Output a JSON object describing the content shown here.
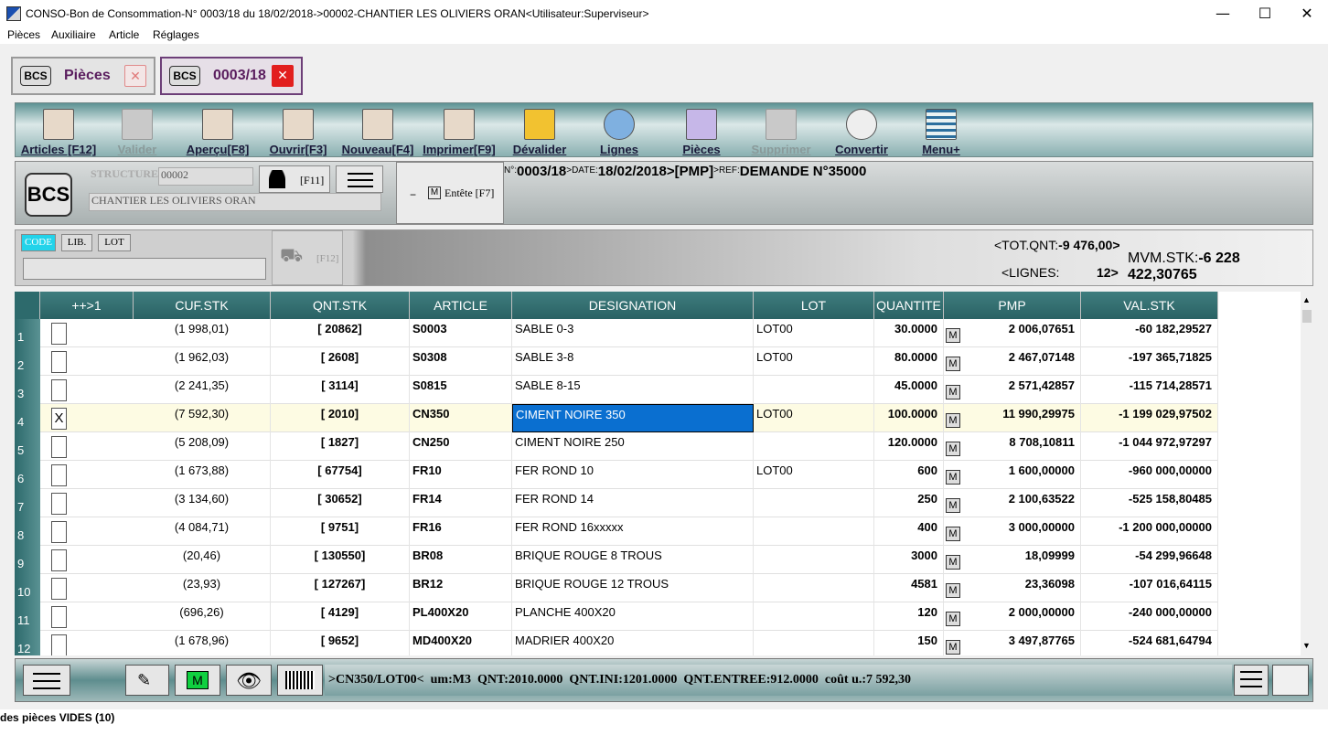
{
  "window": {
    "title": "CONSO-Bon de Consommation-N° 0003/18 du 18/02/2018->00002-CHANTIER LES OLIVIERS ORAN<Utilisateur:Superviseur>",
    "min": "—",
    "max": "☐",
    "close": "✕"
  },
  "menu": [
    "Pièces",
    "Auxiliaire",
    "Article",
    "Réglages"
  ],
  "tabs": [
    {
      "icon": "BCS",
      "label": "Pièces",
      "close": "✕"
    },
    {
      "icon": "BCS",
      "label": "0003/18",
      "close": "✕"
    }
  ],
  "toolbar": [
    "Articles [F12]",
    "Valider",
    "Aperçu[F8]",
    "Ouvrir[F3]",
    "Nouveau[F4]",
    "Imprimer[F9]",
    "Dévalider",
    "Lignes",
    "Pièces",
    "Supprimer",
    "Convertir",
    "Menu+"
  ],
  "header": {
    "logo": "BCS",
    "structure_label": "STRUCTURE",
    "structure_value": "00002",
    "structure_name": "CHANTIER LES OLIVIERS ORAN",
    "f11": "[F11]",
    "entete_m": "M",
    "entete": "Entête [F7]",
    "n_key": "N°:",
    "n_val": "0003/18",
    "date_key": ">DATE:",
    "date_val": "18/02/2018",
    ">pmp": ">[PMP]",
    "ref_key": ">REF:",
    "ref_val": "DEMANDE N°35000"
  },
  "filter": {
    "code": "CODE",
    "lib": "LIB.",
    "lot": "LOT",
    "f12": "[F12]",
    "tot_qnt_label": "<TOT.QNT:",
    "tot_qnt": "-9 476,00>",
    "lignes_label": "<LIGNES:",
    "lignes": "12>",
    "mvm_label": "MVM.STK:",
    "mvm": "-6 228 422,30765"
  },
  "columns": [
    "++>1",
    "CUF.STK",
    "QNT.STK",
    "ARTICLE",
    "DESIGNATION",
    "LOT",
    "QUANTITE",
    "PMP",
    "VAL.STK"
  ],
  "rows": [
    {
      "n": "1",
      "chk": "",
      "cuf": "(1 998,01)",
      "qnt": "[ 20862]",
      "art": "S0003",
      "des": "SABLE 0-3",
      "lot": "LOT00",
      "q": "30.0000",
      "pmp": "2 006,07651",
      "val": "-60 182,29527"
    },
    {
      "n": "2",
      "chk": "",
      "cuf": "(1 962,03)",
      "qnt": "[ 2608]",
      "art": "S0308",
      "des": "SABLE 3-8",
      "lot": "LOT00",
      "q": "80.0000",
      "pmp": "2 467,07148",
      "val": "-197 365,71825"
    },
    {
      "n": "3",
      "chk": "",
      "cuf": "(2 241,35)",
      "qnt": "[ 3114]",
      "art": "S0815",
      "des": "SABLE 8-15",
      "lot": "",
      "q": "45.0000",
      "pmp": "2 571,42857",
      "val": "-115 714,28571"
    },
    {
      "n": "4",
      "chk": "X",
      "cuf": "(7 592,30)",
      "qnt": "[ 2010]",
      "art": "CN350",
      "des": "CIMENT NOIRE 350",
      "lot": "LOT00",
      "q": "100.0000",
      "pmp": "11 990,29975",
      "val": "-1 199 029,97502"
    },
    {
      "n": "5",
      "chk": "",
      "cuf": "(5 208,09)",
      "qnt": "[ 1827]",
      "art": "CN250",
      "des": "CIMENT NOIRE 250",
      "lot": "",
      "q": "120.0000",
      "pmp": "8 708,10811",
      "val": "-1 044 972,97297"
    },
    {
      "n": "6",
      "chk": "",
      "cuf": "(1 673,88)",
      "qnt": "[ 67754]",
      "art": "FR10",
      "des": "FER ROND 10",
      "lot": "LOT00",
      "q": "600",
      "pmp": "1 600,00000",
      "val": "-960 000,00000"
    },
    {
      "n": "7",
      "chk": "",
      "cuf": "(3 134,60)",
      "qnt": "[ 30652]",
      "art": "FR14",
      "des": "FER ROND 14",
      "lot": "",
      "q": "250",
      "pmp": "2 100,63522",
      "val": "-525 158,80485"
    },
    {
      "n": "8",
      "chk": "",
      "cuf": "(4 084,71)",
      "qnt": "[ 9751]",
      "art": "FR16",
      "des": "FER ROND 16xxxxx",
      "lot": "",
      "q": "400",
      "pmp": "3 000,00000",
      "val": "-1 200 000,00000"
    },
    {
      "n": "9",
      "chk": "",
      "cuf": "(20,46)",
      "qnt": "[ 130550]",
      "art": "BR08",
      "des": "BRIQUE ROUGE 8 TROUS",
      "lot": "",
      "q": "3000",
      "pmp": "18,09999",
      "val": "-54 299,96648"
    },
    {
      "n": "10",
      "chk": "",
      "cuf": "(23,93)",
      "qnt": "[ 127267]",
      "art": "BR12",
      "des": "BRIQUE ROUGE 12 TROUS",
      "lot": "",
      "q": "4581",
      "pmp": "23,36098",
      "val": "-107 016,64115"
    },
    {
      "n": "11",
      "chk": "",
      "cuf": "(696,26)",
      "qnt": "[ 4129]",
      "art": "PL400X20",
      "des": "PLANCHE 400X20",
      "lot": "",
      "q": "120",
      "pmp": "2 000,00000",
      "val": "-240 000,00000"
    },
    {
      "n": "12",
      "chk": "",
      "cuf": "(1 678,96)",
      "qnt": "[ 9652]",
      "art": "MD400X20",
      "des": "MADRIER 400X20",
      "lot": "",
      "q": "150",
      "pmp": "3 497,87765",
      "val": "-524 681,64794"
    }
  ],
  "row_m": "M",
  "bottom": {
    "m": "M",
    "info": ">CN350/LOT00<  um:M3  QNT:2010.0000  QNT.INI:1201.0000  QNT.ENTREE:912.0000  coût u.:7 592,30"
  },
  "status": "des pièces VIDES (10)"
}
